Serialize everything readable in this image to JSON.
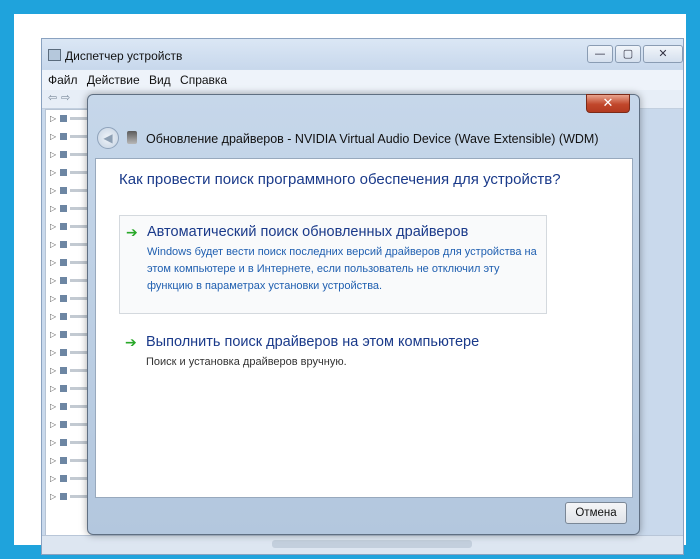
{
  "device_manager": {
    "title": "Диспетчер устройств",
    "menu": [
      "Файл",
      "Действие",
      "Вид",
      "Справка"
    ],
    "window_controls": {
      "minimize": "—",
      "maximize": "▢",
      "close": "✕"
    }
  },
  "dialog": {
    "close_label": "✕",
    "back_icon": "back-arrow-icon",
    "title": "Обновление драйверов - NVIDIA Virtual Audio Device (Wave Extensible) (WDM)",
    "question": "Как провести поиск программного обеспечения для устройств?",
    "options": [
      {
        "title": "Автоматический поиск обновленных драйверов",
        "description": "Windows будет вести поиск последних версий драйверов для устройства на этом компьютере и в Интернете, если пользователь не отключил эту функцию в параметрах установки устройства.",
        "description_color": "#1f5fb0",
        "icon": "green-arrow-icon"
      },
      {
        "title": "Выполнить поиск драйверов на этом компьютере",
        "description": "Поиск и установка драйверов вручную.",
        "description_color": "#333333",
        "icon": "green-arrow-icon"
      }
    ],
    "cancel_label": "Отмена"
  },
  "colors": {
    "background": "#1fa3dc",
    "link_title": "#1a3a8a",
    "arrow": "#29a829",
    "close_button": "#c1472b"
  }
}
